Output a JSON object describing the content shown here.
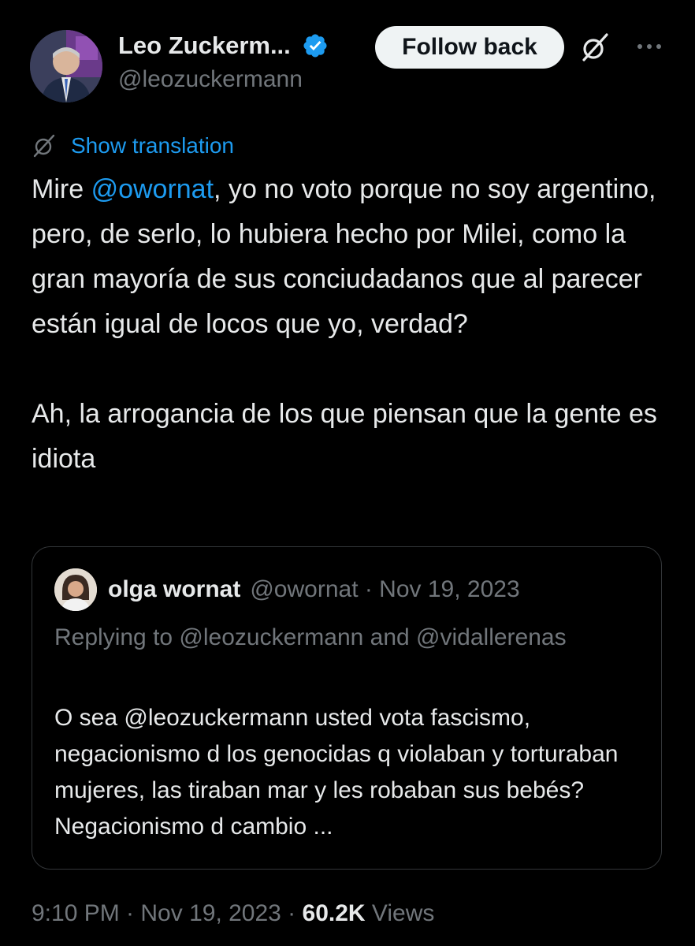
{
  "author": {
    "display_name": "Leo Zuckerm...",
    "handle": "@leozuckermann",
    "verified_icon": "verified-badge-icon"
  },
  "actions": {
    "follow_label": "Follow back",
    "grok_icon": "grok-icon",
    "more_icon": "more-icon"
  },
  "translation": {
    "label": "Show translation",
    "icon": "translation-icon"
  },
  "tweet": {
    "p1_before": "Mire ",
    "p1_mention": "@owornat",
    "p1_after": ", yo no voto porque no soy argentino, pero, de serlo, lo hubiera hecho por Milei, como la gran mayoría de sus conciudadanos que al parecer están igual de locos que yo, verdad?",
    "p2": "Ah, la arrogancia de los que piensan que la gente es idiota"
  },
  "quote": {
    "name": "olga wornat",
    "meta": "@owornat · Nov 19, 2023",
    "replying": "Replying to @leozuckermann and @vidallerenas",
    "text": "O sea @leozuckermann usted vota fascismo, negacionismo d los genocidas q violaban y torturaban mujeres, las tiraban mar y les robaban sus bebés? Negacionismo d cambio ..."
  },
  "footer": {
    "time": "9:10 PM · Nov 19, 2023 · ",
    "views_count": "60.2K",
    "views_label": " Views"
  },
  "colors": {
    "background": "#000000",
    "text": "#e7e9ea",
    "secondary": "#71767b",
    "accent": "#1d9bf0",
    "border": "#333639"
  }
}
